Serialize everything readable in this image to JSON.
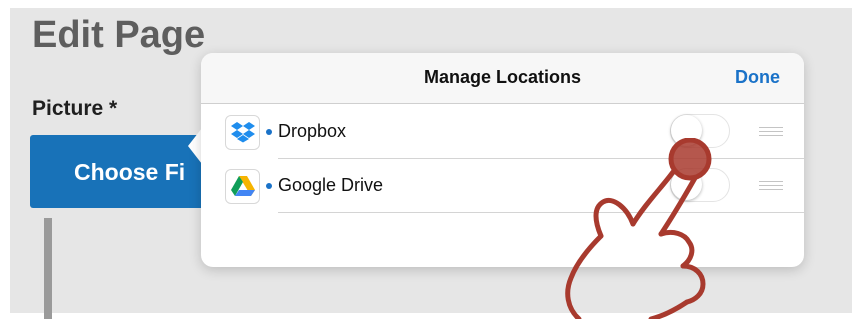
{
  "page": {
    "title": "Edit Page",
    "picture_label": "Picture *",
    "choose_button": "Choose Fi"
  },
  "dialog": {
    "title": "Manage Locations",
    "done_label": "Done",
    "locations": [
      {
        "icon": "dropbox-icon",
        "label": "Dropbox",
        "enabled": false
      },
      {
        "icon": "google-drive-icon",
        "label": "Google Drive",
        "enabled": false
      }
    ]
  },
  "colors": {
    "accent": "#1a72c8",
    "button_bg": "#1872b8",
    "pointer": "#a83a2e"
  }
}
